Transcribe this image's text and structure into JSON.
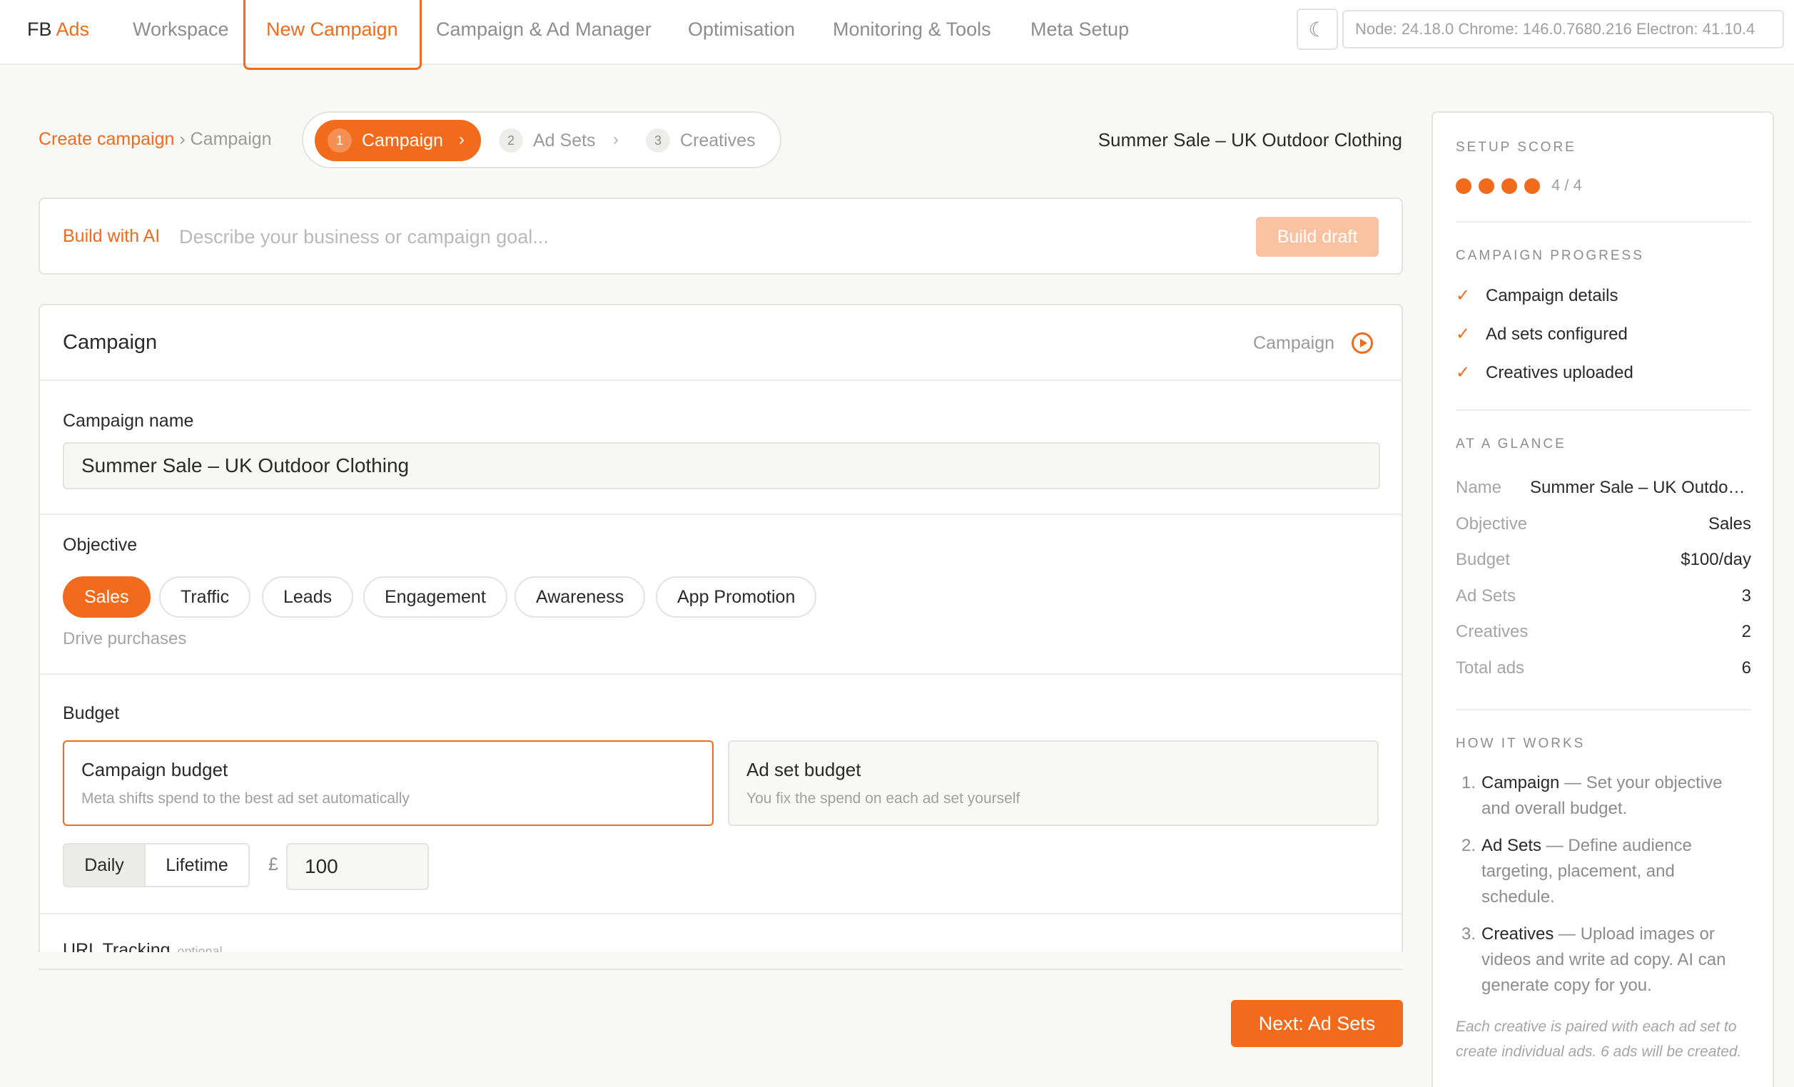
{
  "brand": {
    "prefix": "FB",
    "accent": "Ads"
  },
  "nav": {
    "items": [
      {
        "label": "Workspace"
      },
      {
        "label": "New Campaign"
      },
      {
        "label": "Campaign & Ad Manager"
      },
      {
        "label": "Optimisation"
      },
      {
        "label": "Monitoring & Tools"
      },
      {
        "label": "Meta Setup"
      }
    ],
    "active_index": 1,
    "theme_icon": "moon-icon",
    "theme_glyph": "☾",
    "version": "Node: 24.18.0 Chrome: 146.0.7680.216 Electron: 41.10.4"
  },
  "breadcrumb": {
    "link": "Create campaign",
    "separator": "›",
    "current": "Campaign"
  },
  "steps": [
    {
      "num": "1",
      "label": "Campaign",
      "chevron": "›"
    },
    {
      "num": "2",
      "label": "Ad Sets",
      "chevron": "›"
    },
    {
      "num": "3",
      "label": "Creatives"
    }
  ],
  "campaign_heading": "Summer Sale – UK Outdoor Clothing",
  "ai": {
    "label": "Build with AI",
    "placeholder": "Describe your business or campaign goal...",
    "value": "",
    "button": "Build draft"
  },
  "card": {
    "title": "Campaign",
    "tag": "Campaign",
    "tag_icon": "play-circle-icon",
    "name_label": "Campaign name",
    "name_value": "Summer Sale – UK Outdoor Clothing",
    "objective_label": "Objective",
    "objectives": [
      "Sales",
      "Traffic",
      "Leads",
      "Engagement",
      "Awareness",
      "App Promotion"
    ],
    "objective_selected": "Sales",
    "objective_hint": "Drive purchases",
    "budget_label": "Budget",
    "budget_options": [
      {
        "title": "Campaign budget",
        "desc": "Meta shifts spend to the best ad set automatically"
      },
      {
        "title": "Ad set budget",
        "desc": "You fix the spend on each ad set yourself"
      }
    ],
    "budget_selected": "Campaign budget",
    "budget_period": [
      "Daily",
      "Lifetime"
    ],
    "budget_period_selected": "Daily",
    "currency": "£",
    "amount": "100",
    "url_label": "URL Tracking",
    "url_optional": "optional"
  },
  "next_button": "Next: Ad Sets",
  "panel": {
    "score_heading": "SETUP SCORE",
    "score_value": 4,
    "score_max": 4,
    "score_text": "4 / 4",
    "progress_heading": "CAMPAIGN PROGRESS",
    "progress_check": "✓",
    "progress": [
      "Campaign details",
      "Ad sets configured",
      "Creatives uploaded"
    ],
    "glance_heading": "AT A GLANCE",
    "glance": [
      {
        "k": "Name",
        "v": "Summer Sale – UK Outdoor Clothing"
      },
      {
        "k": "Objective",
        "v": "Sales"
      },
      {
        "k": "Budget",
        "v": "$100/day"
      },
      {
        "k": "Ad Sets",
        "v": "3"
      },
      {
        "k": "Creatives",
        "v": "2"
      },
      {
        "k": "Total ads",
        "v": "6"
      }
    ],
    "how_heading": "HOW IT WORKS",
    "how": [
      {
        "num": "1.",
        "title": "Campaign",
        "text": " — Set your objective and overall budget."
      },
      {
        "num": "2.",
        "title": "Ad Sets",
        "text": " — Define audience targeting, placement, and schedule."
      },
      {
        "num": "3.",
        "title": "Creatives",
        "text": " — Upload images or videos and write ad copy. AI can generate copy for you."
      }
    ],
    "note": "Each creative is paired with each ad set to create individual ads. 6 ads will be created."
  },
  "colors": {
    "accent": "#f26b1d",
    "accent_disabled": "#f9c2a0"
  }
}
